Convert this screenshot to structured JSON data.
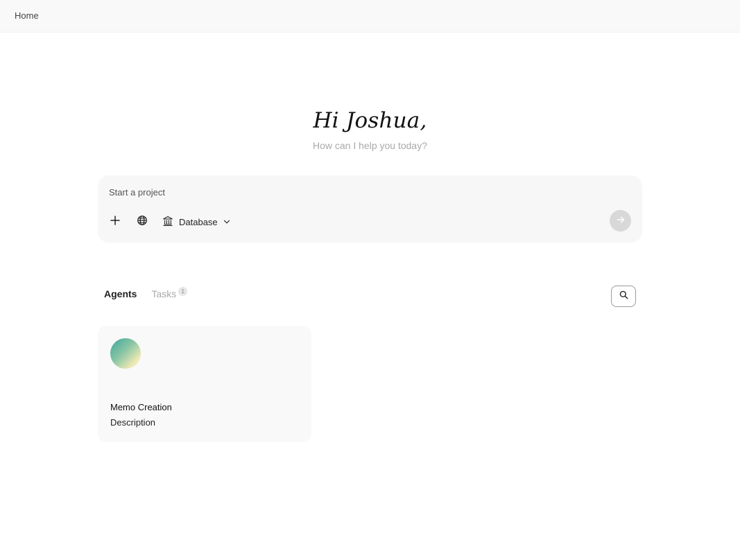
{
  "breadcrumb": {
    "label": "Home"
  },
  "hero": {
    "greeting": "Hi Joshua,",
    "subtitle": "How can I help you today?"
  },
  "composer": {
    "placeholder": "Start a project",
    "value": "",
    "tools": {
      "add_icon": "plus-icon",
      "web_icon": "globe-icon",
      "database_icon": "bank-icon",
      "database_label": "Database",
      "dropdown_icon": "chevron-down-icon"
    },
    "send_icon": "arrow-right-icon"
  },
  "tabs": [
    {
      "label": "Agents",
      "active": true
    },
    {
      "label": "Tasks",
      "active": false,
      "count": "1"
    }
  ],
  "search": {
    "icon": "search-icon"
  },
  "agents": [
    {
      "name": "Memo Creation",
      "description": "Description"
    }
  ],
  "colors": {
    "topbar_bg": "#f9f9f9",
    "composer_bg": "#f7f7f7",
    "send_bg": "#d8d8d8",
    "card_bg": "#f9f9f9",
    "muted_text": "#aaaaaa"
  }
}
